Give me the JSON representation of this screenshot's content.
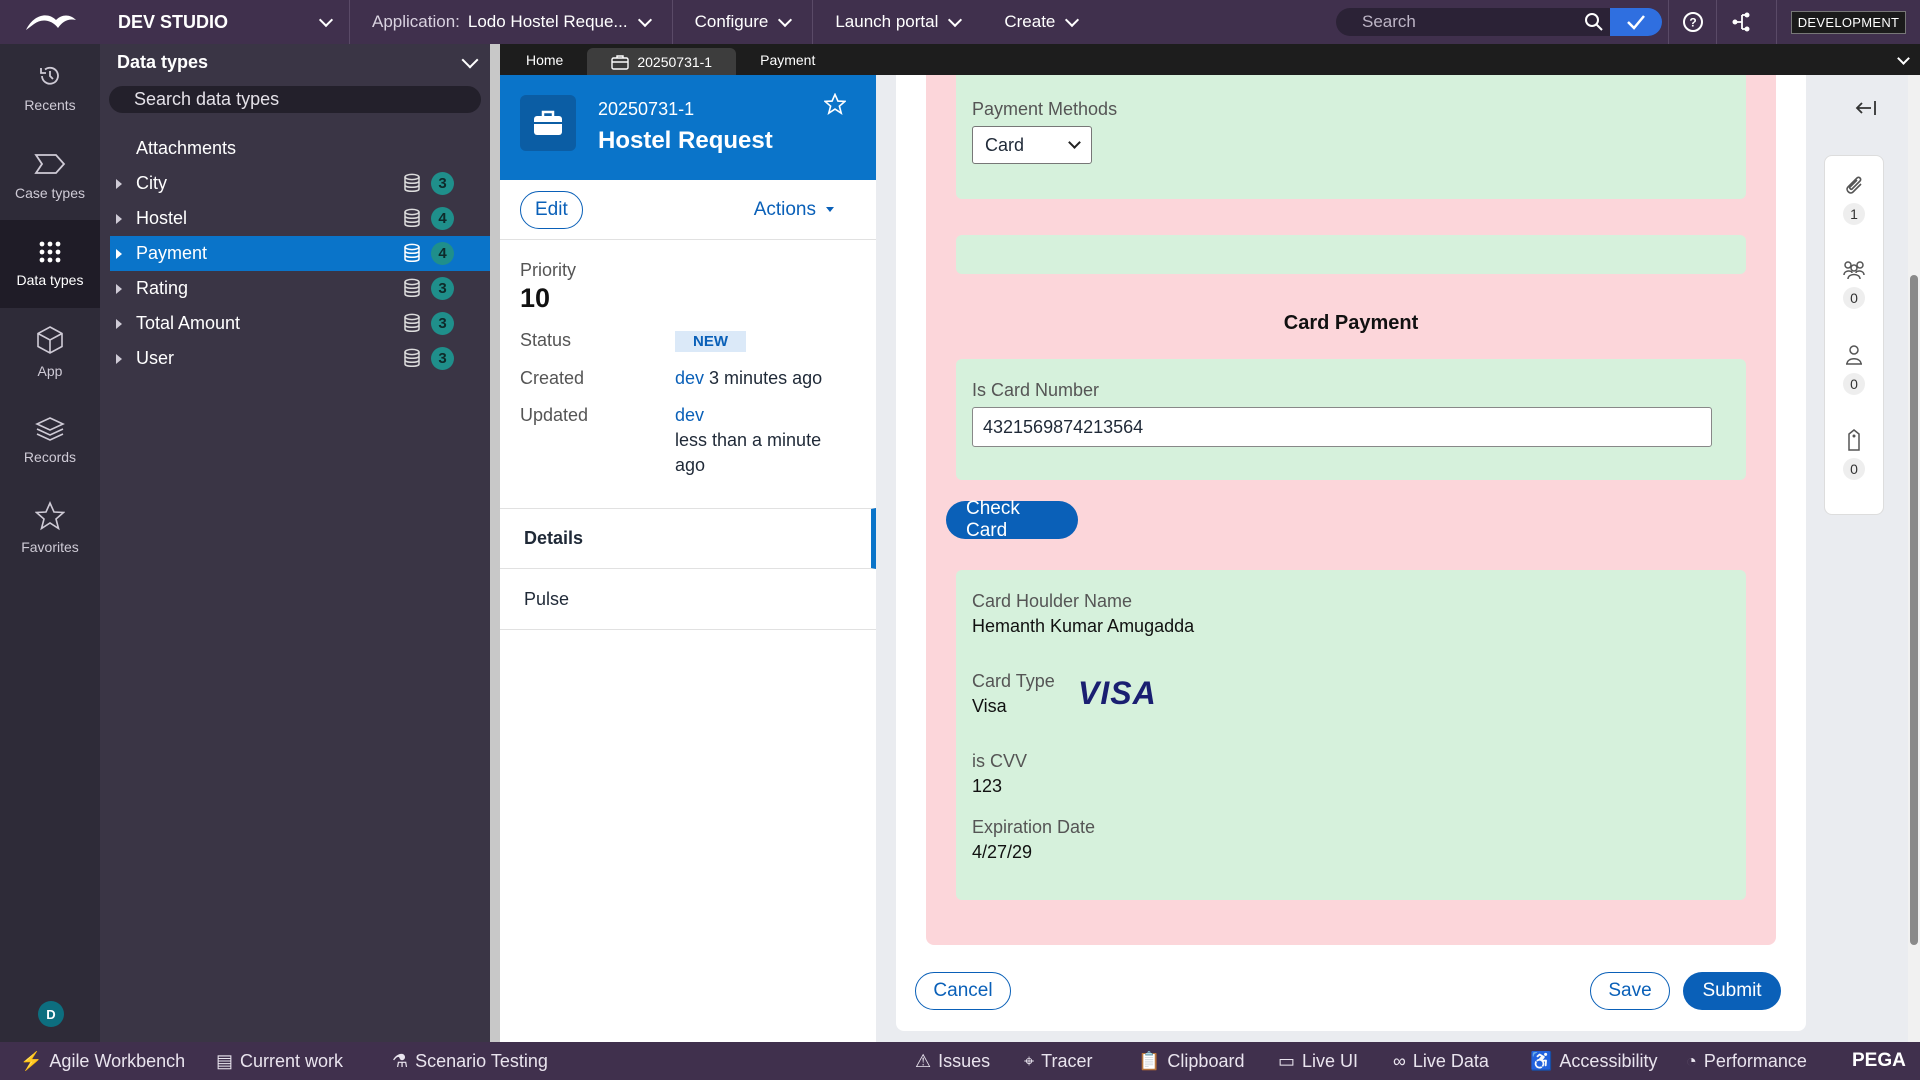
{
  "topbar": {
    "studio": "DEV STUDIO",
    "application": "Application:",
    "application_name": "Lodo Hostel Reque...",
    "configure": "Configure",
    "launch_portal": "Launch portal",
    "create": "Create",
    "search_placeholder": "Search",
    "environment": "DEVELOPMENT"
  },
  "leftnav": {
    "items": [
      {
        "label": "Recents"
      },
      {
        "label": "Case types"
      },
      {
        "label": "Data types"
      },
      {
        "label": "App"
      },
      {
        "label": "Records"
      },
      {
        "label": "Favorites"
      }
    ],
    "avatar": "D"
  },
  "explorer": {
    "title": "Data types",
    "search_placeholder": "Search data types",
    "items": [
      {
        "label": "Attachments"
      },
      {
        "label": "City",
        "count": "3"
      },
      {
        "label": "Hostel",
        "count": "4"
      },
      {
        "label": "Payment",
        "count": "4"
      },
      {
        "label": "Rating",
        "count": "3"
      },
      {
        "label": "Total Amount",
        "count": "3"
      },
      {
        "label": "User",
        "count": "3"
      }
    ]
  },
  "tabs": {
    "home": "Home",
    "case": "20250731-1",
    "payment": "Payment"
  },
  "summary": {
    "case_id": "20250731-1",
    "case_title": "Hostel Request",
    "edit": "Edit",
    "actions": "Actions",
    "priority_label": "Priority",
    "priority_value": "10",
    "status_label": "Status",
    "status_value": "NEW",
    "created_label": "Created",
    "created_by": "dev",
    "created_when": "3 minutes ago",
    "updated_label": "Updated",
    "updated_by": "dev",
    "updated_when": "less than a minute ago",
    "tab_details": "Details",
    "tab_pulse": "Pulse"
  },
  "form": {
    "payment_methods_label": "Payment Methods",
    "payment_methods_value": "Card",
    "section_title": "Card Payment",
    "card_number_label": "Is Card Number",
    "card_number_value": "4321569874213564",
    "check_card": "Check Card",
    "holder_label": "Card Houlder Name",
    "holder_value": "Hemanth Kumar Amugadda",
    "card_type_label": "Card Type",
    "card_type_value": "Visa",
    "card_logo": "VISA",
    "cvv_label": "is CVV",
    "cvv_value": "123",
    "expiration_label": "Expiration Date",
    "expiration_value": "4/27/29",
    "cancel": "Cancel",
    "save": "Save",
    "submit": "Submit"
  },
  "utility": {
    "attachments_count": "1",
    "followers_count": "0",
    "stakeholders_count": "0",
    "tags_count": "0"
  },
  "bottombar": {
    "agile": "Agile Workbench",
    "current_work": "Current work",
    "scenario": "Scenario Testing",
    "issues": "Issues",
    "tracer": "Tracer",
    "clipboard": "Clipboard",
    "live_ui": "Live UI",
    "live_data": "Live Data",
    "accessibility": "Accessibility",
    "performance": "Performance",
    "brand": "PEGA"
  },
  "colors": {
    "topbar": "#40304d",
    "accent": "#0a74c9",
    "pink_section": "#fcd6da",
    "green_section": "#d6f1dc"
  }
}
